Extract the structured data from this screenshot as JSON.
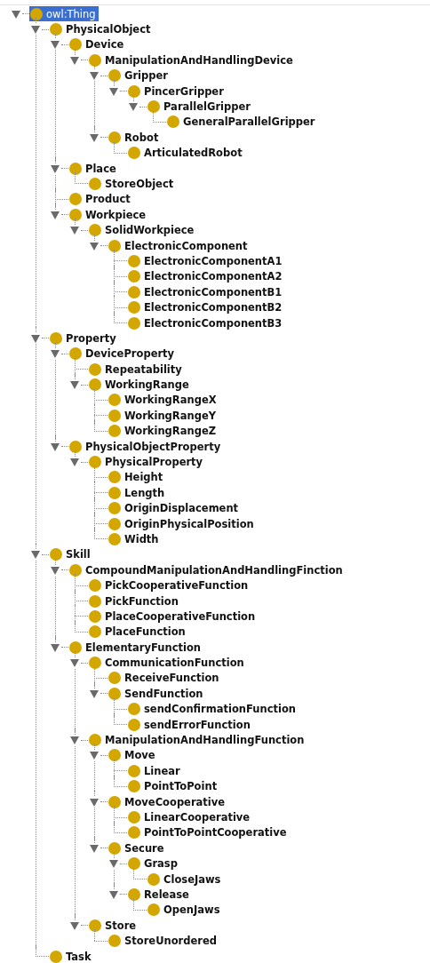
{
  "class_tree": {
    "label": "owl:Thing",
    "selected": true,
    "expanded": true,
    "children": [
      {
        "label": "PhysicalObject",
        "selected": false,
        "expanded": true,
        "children": [
          {
            "label": "Device",
            "selected": false,
            "expanded": true,
            "children": [
              {
                "label": "ManipulationAndHandlingDevice",
                "selected": false,
                "expanded": true,
                "children": [
                  {
                    "label": "Gripper",
                    "selected": false,
                    "expanded": true,
                    "children": [
                      {
                        "label": "PincerGripper",
                        "selected": false,
                        "expanded": true,
                        "children": [
                          {
                            "label": "ParallelGripper",
                            "selected": false,
                            "expanded": true,
                            "children": [
                              {
                                "label": "GeneralParallelGripper",
                                "selected": false
                              }
                            ]
                          }
                        ]
                      }
                    ]
                  },
                  {
                    "label": "Robot",
                    "selected": false,
                    "expanded": true,
                    "children": [
                      {
                        "label": "ArticulatedRobot",
                        "selected": false
                      }
                    ]
                  }
                ]
              }
            ]
          },
          {
            "label": "Place",
            "selected": false,
            "expanded": true,
            "children": [
              {
                "label": "StoreObject",
                "selected": false
              }
            ]
          },
          {
            "label": "Product",
            "selected": false
          },
          {
            "label": "Workpiece",
            "selected": false,
            "expanded": true,
            "children": [
              {
                "label": "SolidWorkpiece",
                "selected": false,
                "expanded": true,
                "children": [
                  {
                    "label": "ElectronicComponent",
                    "selected": false,
                    "expanded": true,
                    "children": [
                      {
                        "label": "ElectronicComponentA1",
                        "selected": false
                      },
                      {
                        "label": "ElectronicComponentA2",
                        "selected": false
                      },
                      {
                        "label": "ElectronicComponentB1",
                        "selected": false
                      },
                      {
                        "label": "ElectronicComponentB2",
                        "selected": false
                      },
                      {
                        "label": "ElectronicComponentB3",
                        "selected": false
                      }
                    ]
                  }
                ]
              }
            ]
          }
        ]
      },
      {
        "label": "Property",
        "selected": false,
        "expanded": true,
        "children": [
          {
            "label": "DeviceProperty",
            "selected": false,
            "expanded": true,
            "children": [
              {
                "label": "Repeatability",
                "selected": false
              },
              {
                "label": "WorkingRange",
                "selected": false,
                "expanded": true,
                "children": [
                  {
                    "label": "WorkingRangeX",
                    "selected": false
                  },
                  {
                    "label": "WorkingRangeY",
                    "selected": false
                  },
                  {
                    "label": "WorkingRangeZ",
                    "selected": false
                  }
                ]
              }
            ]
          },
          {
            "label": "PhysicalObjectProperty",
            "selected": false,
            "expanded": true,
            "children": [
              {
                "label": "PhysicalProperty",
                "selected": false,
                "expanded": true,
                "children": [
                  {
                    "label": "Height",
                    "selected": false
                  },
                  {
                    "label": "Length",
                    "selected": false
                  },
                  {
                    "label": "OriginDisplacement",
                    "selected": false
                  },
                  {
                    "label": "OriginPhysicalPosition",
                    "selected": false
                  },
                  {
                    "label": "Width",
                    "selected": false
                  }
                ]
              }
            ]
          }
        ]
      },
      {
        "label": "Skill",
        "selected": false,
        "expanded": true,
        "children": [
          {
            "label": "CompoundManipulationAndHandlingFinction",
            "selected": false,
            "expanded": true,
            "children": [
              {
                "label": "PickCooperativeFunction",
                "selected": false
              },
              {
                "label": "PickFunction",
                "selected": false
              },
              {
                "label": "PlaceCooperativeFunction",
                "selected": false
              },
              {
                "label": "PlaceFunction",
                "selected": false
              }
            ]
          },
          {
            "label": "ElementaryFunction",
            "selected": false,
            "expanded": true,
            "children": [
              {
                "label": "CommunicationFunction",
                "selected": false,
                "expanded": true,
                "children": [
                  {
                    "label": "ReceiveFunction",
                    "selected": false
                  },
                  {
                    "label": "SendFunction",
                    "selected": false,
                    "expanded": true,
                    "children": [
                      {
                        "label": "sendConfirmationFunction",
                        "selected": false
                      },
                      {
                        "label": "sendErrorFunction",
                        "selected": false
                      }
                    ]
                  }
                ]
              },
              {
                "label": "ManipulationAndHandlingFunction",
                "selected": false,
                "expanded": true,
                "children": [
                  {
                    "label": "Move",
                    "selected": false,
                    "expanded": true,
                    "children": [
                      {
                        "label": "Linear",
                        "selected": false
                      },
                      {
                        "label": "PointToPoint",
                        "selected": false
                      }
                    ]
                  },
                  {
                    "label": "MoveCooperative",
                    "selected": false,
                    "expanded": true,
                    "children": [
                      {
                        "label": "LinearCooperative",
                        "selected": false
                      },
                      {
                        "label": "PointToPointCooperative",
                        "selected": false
                      }
                    ]
                  },
                  {
                    "label": "Secure",
                    "selected": false,
                    "expanded": true,
                    "children": [
                      {
                        "label": "Grasp",
                        "selected": false,
                        "expanded": true,
                        "children": [
                          {
                            "label": "CloseJaws",
                            "selected": false
                          }
                        ]
                      },
                      {
                        "label": "Release",
                        "selected": false,
                        "expanded": true,
                        "children": [
                          {
                            "label": "OpenJaws",
                            "selected": false
                          }
                        ]
                      }
                    ]
                  }
                ]
              },
              {
                "label": "Store",
                "selected": false,
                "expanded": true,
                "children": [
                  {
                    "label": "StoreUnordered",
                    "selected": false
                  }
                ]
              }
            ]
          }
        ]
      },
      {
        "label": "Task",
        "selected": false
      }
    ]
  }
}
